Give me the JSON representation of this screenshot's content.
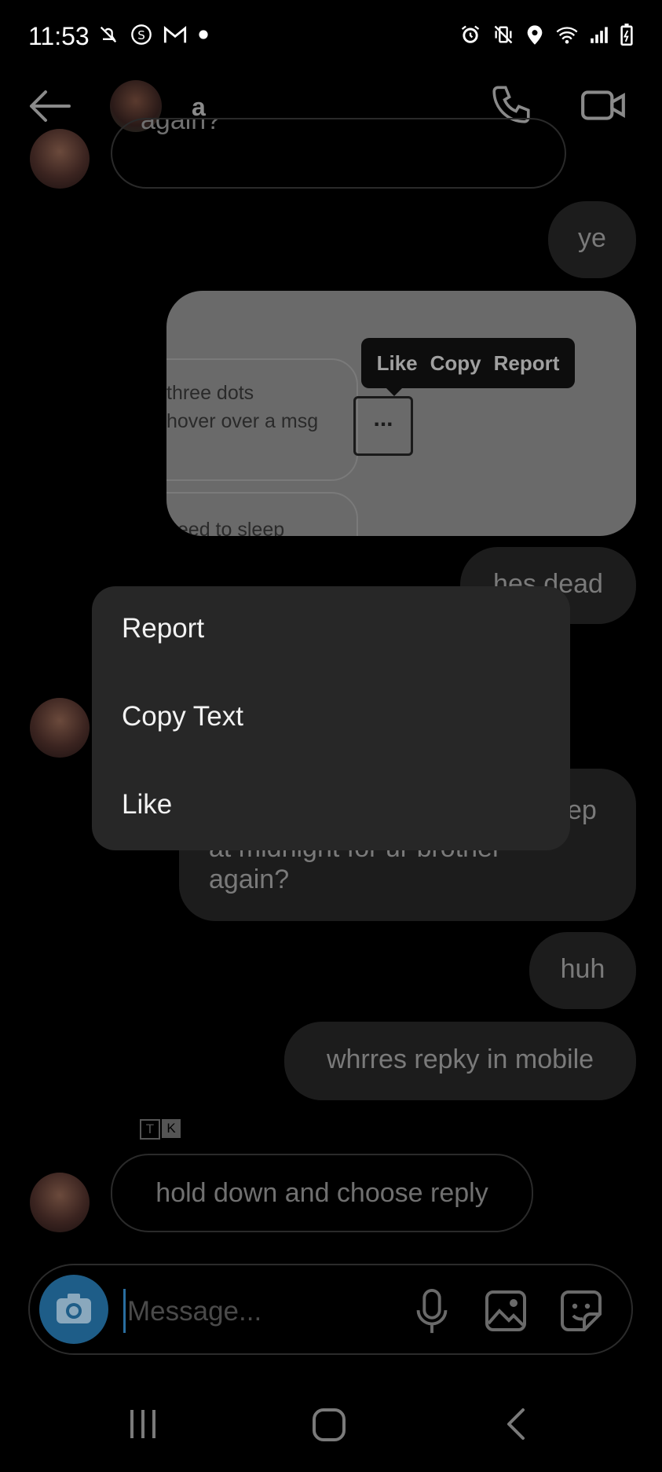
{
  "status_bar": {
    "time": "11:53",
    "left_icons": [
      "mute-bell-icon",
      "s-app-icon",
      "gmail-icon",
      "dot-icon"
    ],
    "right_icons": [
      "alarm-icon",
      "vibrate-icon",
      "location-icon",
      "wifi-icon",
      "signal-icon",
      "battery-icon"
    ]
  },
  "header": {
    "contact_name": "a",
    "back_icon": "arrow-left-icon",
    "call_icon": "phone-icon",
    "video_icon": "video-camera-icon"
  },
  "messages": {
    "partial_top": "again?",
    "out_ye": "ye",
    "image_preview": {
      "tooltip_like": "Like",
      "tooltip_copy": "Copy",
      "tooltip_report": "Report",
      "line1": "three dots",
      "line2": "hover over a msg",
      "line3": "need to sleep",
      "dots": "..."
    },
    "out_hes_dead": "hes dead",
    "out_partial_tail": "ep",
    "out_partial_line2": "at midnight for ur brother",
    "out_partial_line3": "again?",
    "out_huh": "huh",
    "out_whrres": "whrres repky in mobile",
    "reaction_tag_t": "T",
    "reaction_tag_k": "K",
    "in_hold_down": "hold down and choose reply"
  },
  "context_menu": {
    "items": [
      {
        "label": "Report"
      },
      {
        "label": "Copy Text"
      },
      {
        "label": "Like"
      }
    ]
  },
  "composer": {
    "placeholder": "Message...",
    "mic_icon": "microphone-icon",
    "image_icon": "image-icon",
    "sticker_icon": "sticker-icon",
    "camera_icon": "camera-icon"
  },
  "nav_bar": {
    "recents_icon": "recents-icon",
    "home_icon": "home-icon",
    "back_icon": "nav-back-icon"
  }
}
